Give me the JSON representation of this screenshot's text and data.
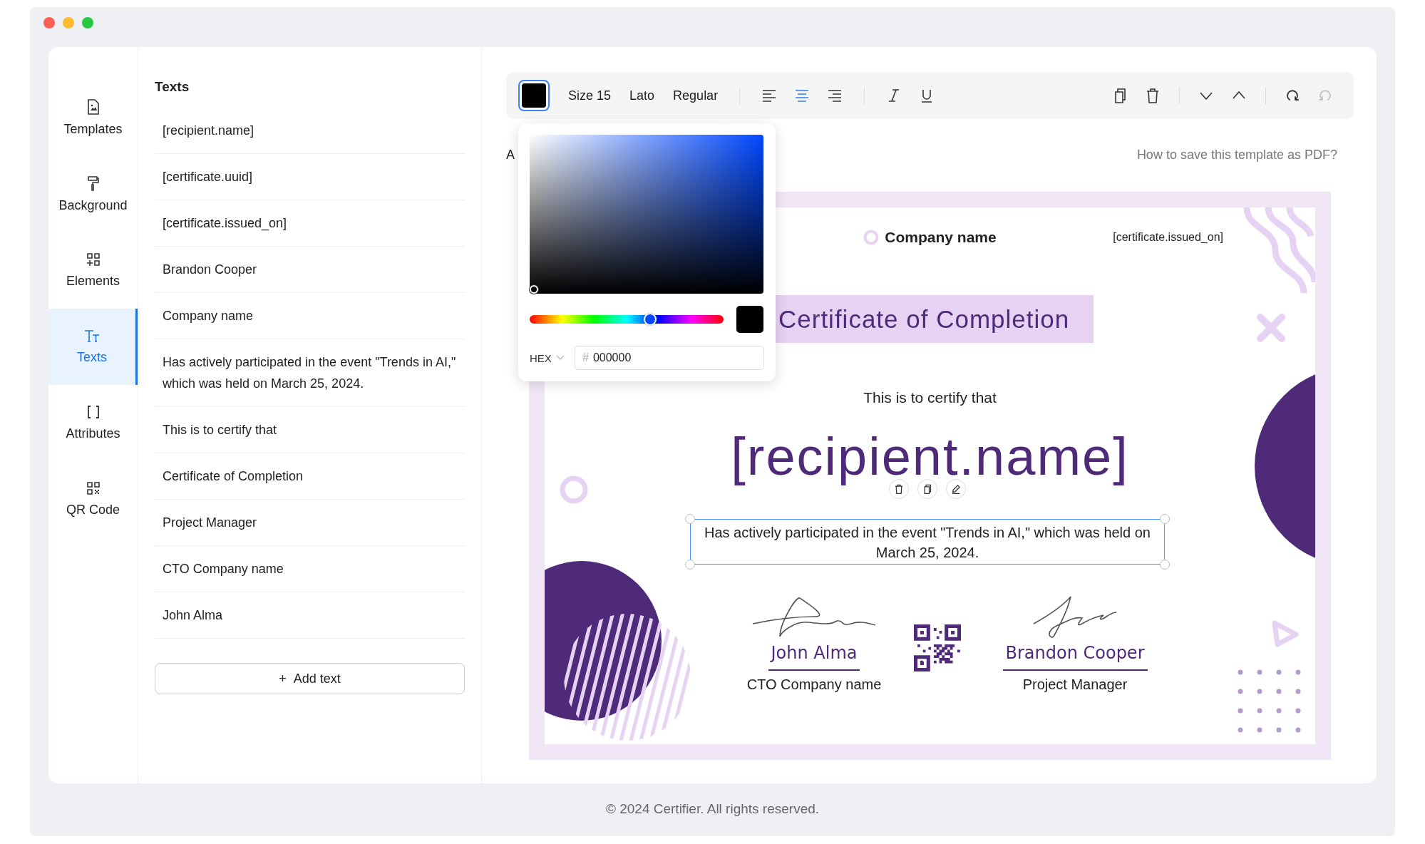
{
  "nav": [
    {
      "kind": "templates",
      "label": "Templates",
      "selected": false
    },
    {
      "kind": "background",
      "label": "Background",
      "selected": false
    },
    {
      "kind": "elements",
      "label": "Elements",
      "selected": false
    },
    {
      "kind": "texts",
      "label": "Texts",
      "selected": true
    },
    {
      "kind": "attributes",
      "label": "Attributes",
      "selected": false
    },
    {
      "kind": "qr",
      "label": "QR Code",
      "selected": false
    }
  ],
  "texts_panel": {
    "title": "Texts",
    "items": [
      "[recipient.name]",
      "[certificate.uuid]",
      "[certificate.issued_on]",
      "Brandon Cooper",
      "Company name",
      "Has actively participated in the event \"Trends in AI,\" which was held on March 25, 2024.",
      "This is to certify that",
      "Certificate of Completion",
      "Project Manager",
      "CTO Company name",
      "John Alma"
    ],
    "add_icon": "+",
    "add_label": "Add text"
  },
  "toolbar": {
    "size": "Size 15",
    "font": "Lato",
    "weight": "Regular",
    "align": [
      {
        "kind": "left",
        "selected": false
      },
      {
        "kind": "center",
        "selected": true
      },
      {
        "kind": "right",
        "selected": false
      }
    ],
    "history": [
      {
        "kind": "undo",
        "disabled": false
      },
      {
        "kind": "redo",
        "disabled": true
      }
    ]
  },
  "color_picker": {
    "level": 0.62,
    "format": "HEX",
    "hash": "#",
    "value": "000000"
  },
  "canvas": {
    "paper": "A",
    "help_link": "How to save this template as PDF?"
  },
  "certificate": {
    "company": "Company name",
    "issued_on": "[certificate.issued_on]",
    "title": "Certificate of Completion",
    "intro": "This is to certify that",
    "recipient": "[recipient.name]",
    "description": {
      "text": "Has actively participated in the event \"Trends in AI,\" which was held on March 25, 2024.",
      "selected": true
    },
    "signatures": [
      {
        "name": "John Alma",
        "role": "CTO Company name"
      },
      {
        "name": "Brandon Cooper",
        "role": "Project Manager"
      }
    ]
  },
  "footer": "© 2024 Certifier. All rights reserved."
}
